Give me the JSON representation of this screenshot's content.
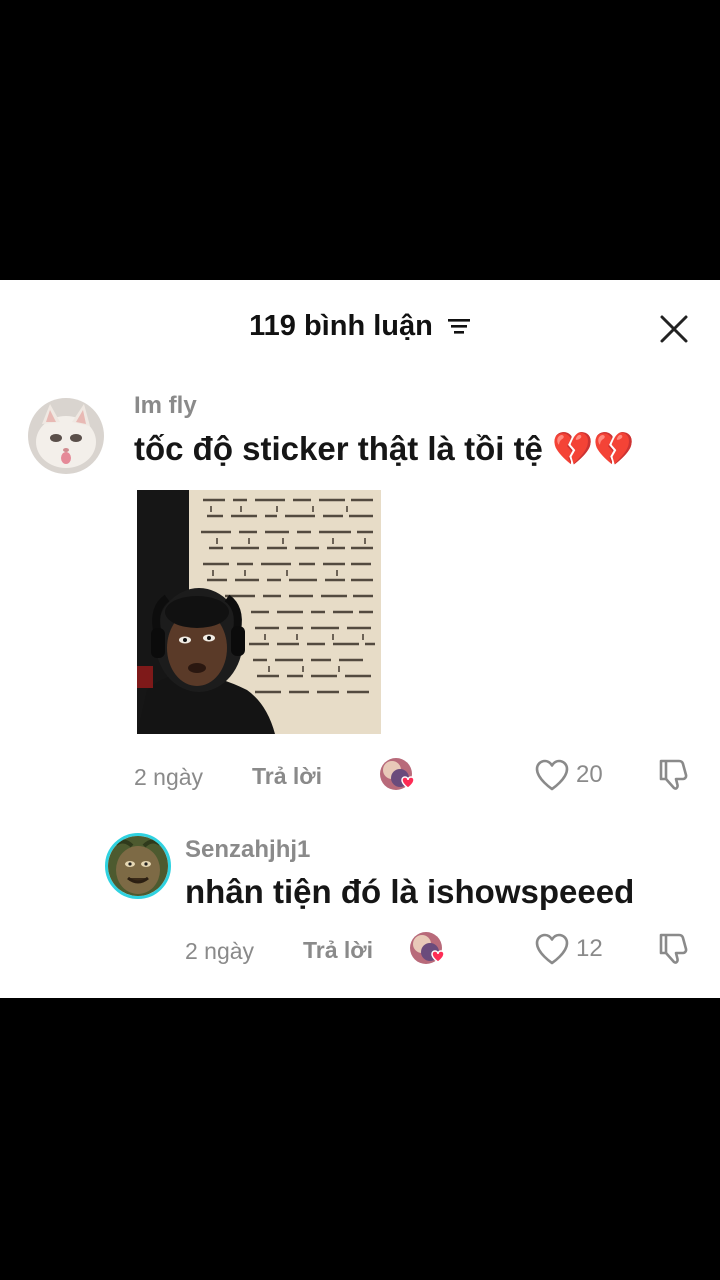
{
  "header": {
    "title": "119 bình luận",
    "filter_icon": "filter-lines-icon",
    "close_icon": "close-icon"
  },
  "comments": [
    {
      "username": "Im fly",
      "text": "tốc độ sticker thật là tồi tệ 💔💔",
      "time": "2 ngày",
      "reply_label": "Trả lời",
      "likes": "20"
    }
  ],
  "replies": [
    {
      "username": "Senzahjhj1",
      "text": "nhân tiện đó là ishowspeeed",
      "time": "2 ngày",
      "reply_label": "Trả lời",
      "likes": "12"
    }
  ],
  "colors": {
    "panel": "#ffffff",
    "muted": "#8a8a8a",
    "text": "#161616",
    "reply_ring": "#2fd2e0",
    "heart_pink": "#fe2c55"
  }
}
